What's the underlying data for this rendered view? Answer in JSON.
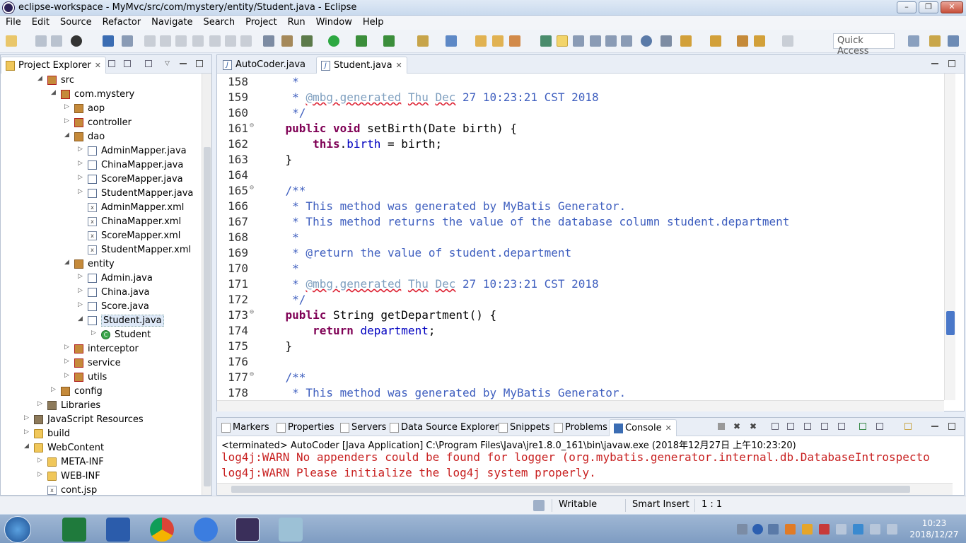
{
  "window": {
    "title": "eclipse-workspace - MyMvc/src/com/mystery/entity/Student.java - Eclipse",
    "minimize": "–",
    "maximize": "❐",
    "close": "✕"
  },
  "menu": [
    "File",
    "Edit",
    "Source",
    "Refactor",
    "Navigate",
    "Search",
    "Project",
    "Run",
    "Window",
    "Help"
  ],
  "toolbar": {
    "quick_access": "Quick Access"
  },
  "explorer": {
    "title": "Project Explorer",
    "tree": [
      {
        "label": "src",
        "depth": 3,
        "icon": "srcf",
        "arrow": "◢"
      },
      {
        "label": "com.mystery",
        "depth": 4,
        "icon": "pkgx",
        "arrow": "◢"
      },
      {
        "label": "aop",
        "depth": 5,
        "icon": "pkg",
        "arrow": "▷"
      },
      {
        "label": "controller",
        "depth": 5,
        "icon": "pkgx",
        "arrow": "▷"
      },
      {
        "label": "dao",
        "depth": 5,
        "icon": "pkg",
        "arrow": "◢"
      },
      {
        "label": "AdminMapper.java",
        "depth": 6,
        "icon": "jfile",
        "arrow": "▷"
      },
      {
        "label": "ChinaMapper.java",
        "depth": 6,
        "icon": "jfile",
        "arrow": "▷"
      },
      {
        "label": "ScoreMapper.java",
        "depth": 6,
        "icon": "jfile",
        "arrow": "▷"
      },
      {
        "label": "StudentMapper.java",
        "depth": 6,
        "icon": "jfile",
        "arrow": "▷"
      },
      {
        "label": "AdminMapper.xml",
        "depth": 6,
        "icon": "xfile",
        "arrow": ""
      },
      {
        "label": "ChinaMapper.xml",
        "depth": 6,
        "icon": "xfile",
        "arrow": ""
      },
      {
        "label": "ScoreMapper.xml",
        "depth": 6,
        "icon": "xfile",
        "arrow": ""
      },
      {
        "label": "StudentMapper.xml",
        "depth": 6,
        "icon": "xfile",
        "arrow": ""
      },
      {
        "label": "entity",
        "depth": 5,
        "icon": "pkg",
        "arrow": "◢"
      },
      {
        "label": "Admin.java",
        "depth": 6,
        "icon": "jfile",
        "arrow": "▷"
      },
      {
        "label": "China.java",
        "depth": 6,
        "icon": "jfile",
        "arrow": "▷"
      },
      {
        "label": "Score.java",
        "depth": 6,
        "icon": "jfile",
        "arrow": "▷"
      },
      {
        "label": "Student.java",
        "depth": 6,
        "icon": "jfile",
        "arrow": "◢",
        "selected": true
      },
      {
        "label": "Student",
        "depth": 7,
        "icon": "cls",
        "arrow": "▷"
      },
      {
        "label": "interceptor",
        "depth": 5,
        "icon": "pkgx",
        "arrow": "▷"
      },
      {
        "label": "service",
        "depth": 5,
        "icon": "pkgx",
        "arrow": "▷"
      },
      {
        "label": "utils",
        "depth": 5,
        "icon": "pkgx",
        "arrow": "▷"
      },
      {
        "label": "config",
        "depth": 4,
        "icon": "pkg",
        "arrow": "▷"
      },
      {
        "label": "Libraries",
        "depth": 3,
        "icon": "lib",
        "arrow": "▷"
      },
      {
        "label": "JavaScript Resources",
        "depth": 2,
        "icon": "lib",
        "arrow": "▷"
      },
      {
        "label": "build",
        "depth": 2,
        "icon": "folder",
        "arrow": "▷"
      },
      {
        "label": "WebContent",
        "depth": 2,
        "icon": "folder",
        "arrow": "◢"
      },
      {
        "label": "META-INF",
        "depth": 3,
        "icon": "folder",
        "arrow": "▷"
      },
      {
        "label": "WEB-INF",
        "depth": 3,
        "icon": "folder",
        "arrow": "▷"
      },
      {
        "label": "cont.jsp",
        "depth": 3,
        "icon": "xfile",
        "arrow": ""
      }
    ]
  },
  "editor": {
    "tabs": [
      {
        "label": "AutoCoder.java",
        "active": false
      },
      {
        "label": "Student.java",
        "active": true
      }
    ],
    "lines": [
      {
        "n": "158",
        "fold": "",
        "parts": [
          {
            "t": "     *",
            "c": "c"
          }
        ]
      },
      {
        "n": "159",
        "fold": "",
        "parts": [
          {
            "t": "     * ",
            "c": "c"
          },
          {
            "t": "@mbg.generated",
            "c": "ann"
          },
          {
            "t": " ",
            "c": "c"
          },
          {
            "t": "Thu",
            "c": "ann"
          },
          {
            "t": " ",
            "c": "c"
          },
          {
            "t": "Dec",
            "c": "ann"
          },
          {
            "t": " 27 10:23:21 CST 2018",
            "c": "c"
          }
        ]
      },
      {
        "n": "160",
        "fold": "",
        "parts": [
          {
            "t": "     */",
            "c": "c"
          }
        ]
      },
      {
        "n": "161",
        "fold": "⊖",
        "parts": [
          {
            "t": "    ",
            "c": ""
          },
          {
            "t": "public void",
            "c": "kw"
          },
          {
            "t": " setBirth(Date birth) {",
            "c": ""
          }
        ]
      },
      {
        "n": "162",
        "fold": "",
        "parts": [
          {
            "t": "        ",
            "c": ""
          },
          {
            "t": "this",
            "c": "kw"
          },
          {
            "t": ".",
            "c": ""
          },
          {
            "t": "birth",
            "c": "fld"
          },
          {
            "t": " = birth;",
            "c": ""
          }
        ]
      },
      {
        "n": "163",
        "fold": "",
        "parts": [
          {
            "t": "    }",
            "c": ""
          }
        ]
      },
      {
        "n": "164",
        "fold": "",
        "parts": [
          {
            "t": "",
            "c": ""
          }
        ]
      },
      {
        "n": "165",
        "fold": "⊖",
        "parts": [
          {
            "t": "    /**",
            "c": "c"
          }
        ]
      },
      {
        "n": "166",
        "fold": "",
        "parts": [
          {
            "t": "     * This method was generated by MyBatis Generator.",
            "c": "c"
          }
        ]
      },
      {
        "n": "167",
        "fold": "",
        "parts": [
          {
            "t": "     * This method returns the value of the database column student.department",
            "c": "c"
          }
        ]
      },
      {
        "n": "168",
        "fold": "",
        "parts": [
          {
            "t": "     *",
            "c": "c"
          }
        ]
      },
      {
        "n": "169",
        "fold": "",
        "parts": [
          {
            "t": "     * @return the value of student.department",
            "c": "c"
          }
        ]
      },
      {
        "n": "170",
        "fold": "",
        "parts": [
          {
            "t": "     *",
            "c": "c"
          }
        ]
      },
      {
        "n": "171",
        "fold": "",
        "parts": [
          {
            "t": "     * ",
            "c": "c"
          },
          {
            "t": "@mbg.generated",
            "c": "ann"
          },
          {
            "t": " ",
            "c": "c"
          },
          {
            "t": "Thu",
            "c": "ann"
          },
          {
            "t": " ",
            "c": "c"
          },
          {
            "t": "Dec",
            "c": "ann"
          },
          {
            "t": " 27 10:23:21 CST 2018",
            "c": "c"
          }
        ]
      },
      {
        "n": "172",
        "fold": "",
        "parts": [
          {
            "t": "     */",
            "c": "c"
          }
        ]
      },
      {
        "n": "173",
        "fold": "⊖",
        "parts": [
          {
            "t": "    ",
            "c": ""
          },
          {
            "t": "public",
            "c": "kw"
          },
          {
            "t": " String getDepartment() {",
            "c": ""
          }
        ]
      },
      {
        "n": "174",
        "fold": "",
        "parts": [
          {
            "t": "        ",
            "c": ""
          },
          {
            "t": "return",
            "c": "kw"
          },
          {
            "t": " ",
            "c": ""
          },
          {
            "t": "department",
            "c": "fld"
          },
          {
            "t": ";",
            "c": ""
          }
        ]
      },
      {
        "n": "175",
        "fold": "",
        "parts": [
          {
            "t": "    }",
            "c": ""
          }
        ]
      },
      {
        "n": "176",
        "fold": "",
        "parts": [
          {
            "t": "",
            "c": ""
          }
        ]
      },
      {
        "n": "177",
        "fold": "⊖",
        "parts": [
          {
            "t": "    /**",
            "c": "c"
          }
        ]
      },
      {
        "n": "178",
        "fold": "",
        "parts": [
          {
            "t": "     * This method was generated by MyBatis Generator.",
            "c": "c"
          }
        ]
      }
    ]
  },
  "bottom_tabs": [
    "Markers",
    "Properties",
    "Servers",
    "Data Source Explorer",
    "Snippets",
    "Problems",
    "Console"
  ],
  "console": {
    "status": "<terminated> AutoCoder [Java Application] C:\\Program Files\\Java\\jre1.8.0_161\\bin\\javaw.exe (2018年12月27日 上午10:23:20)",
    "lines": [
      "log4j:WARN No appenders could be found for logger (org.mybatis.generator.internal.db.DatabaseIntrospecto",
      "log4j:WARN Please initialize the log4j system properly."
    ]
  },
  "statusbar": {
    "writable": "Writable",
    "insert_mode": "Smart Insert",
    "position": "1 : 1"
  },
  "taskbar": {
    "time": "10:23",
    "date": "2018/12/27"
  },
  "colors": {
    "comment": "#3f5fbf",
    "keyword": "#7f0055",
    "field": "#0000c0",
    "warn": "#c82020",
    "accent": "#4a78c9"
  }
}
